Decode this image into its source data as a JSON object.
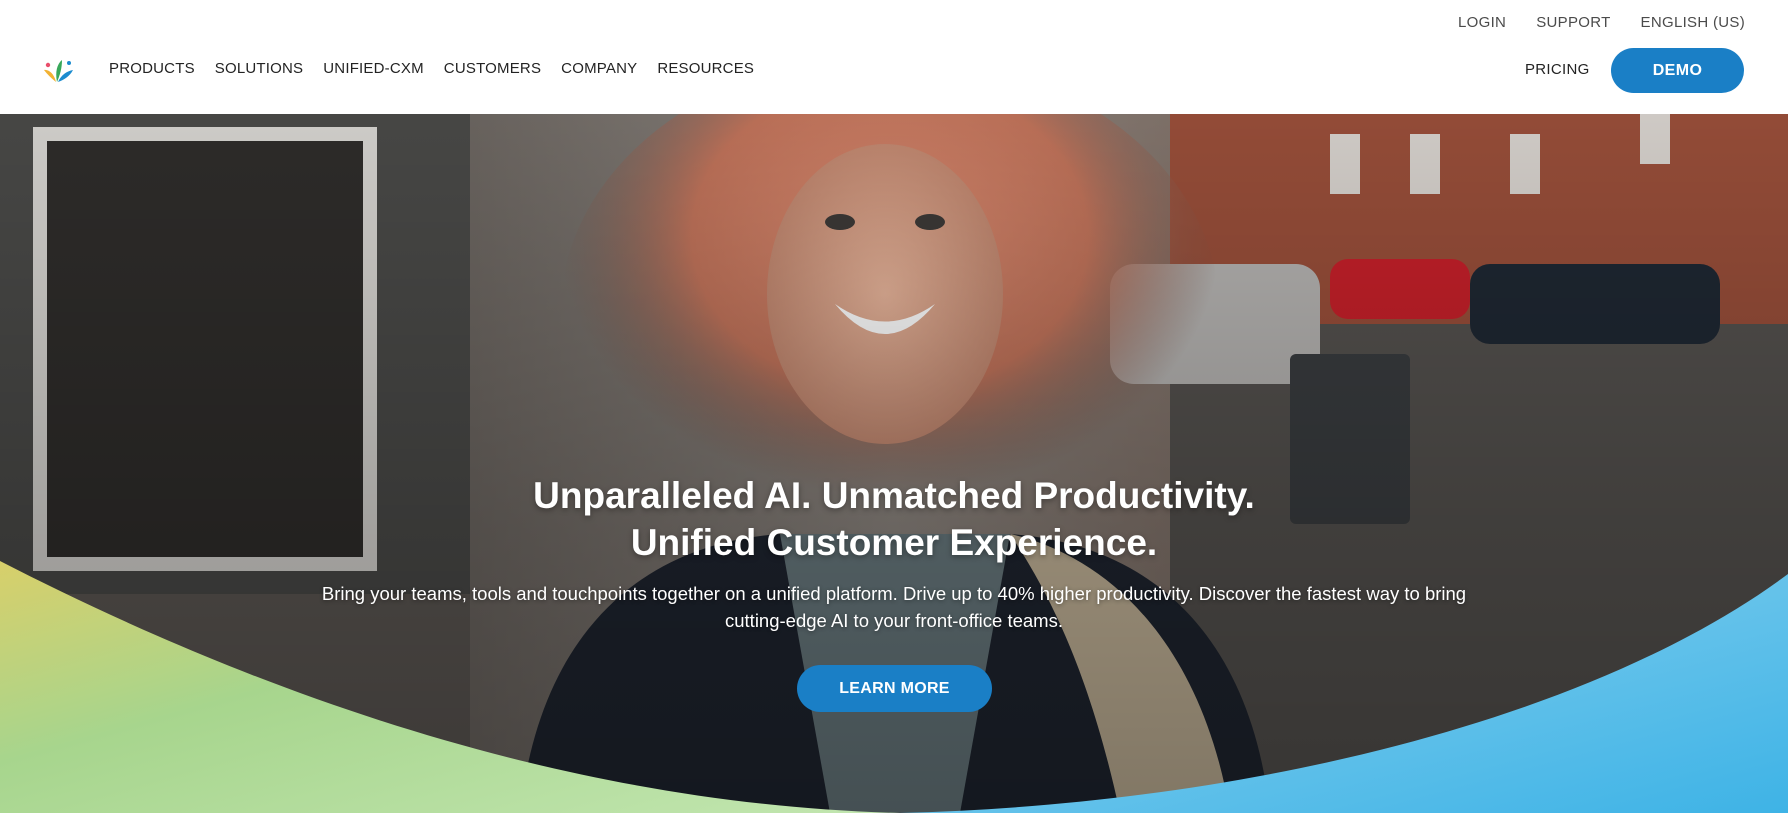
{
  "utility_nav": [
    {
      "label": "LOGIN"
    },
    {
      "label": "SUPPORT"
    },
    {
      "label": "ENGLISH (US)"
    }
  ],
  "main_nav": [
    {
      "label": "PRODUCTS"
    },
    {
      "label": "SOLUTIONS"
    },
    {
      "label": "UNIFIED-CXM"
    },
    {
      "label": "CUSTOMERS"
    },
    {
      "label": "COMPANY"
    },
    {
      "label": "RESOURCES"
    }
  ],
  "header": {
    "logo_icon": "brand-splash-logo",
    "pricing_label": "PRICING",
    "demo_label": "DEMO"
  },
  "hero": {
    "headline_line1": "Unparalleled AI. Unmatched Productivity.",
    "headline_line2": "Unified Customer Experience.",
    "subcopy": "Bring your teams, tools and touchpoints together on a unified platform. Drive up to 40% higher productivity. Discover the fastest way to bring cutting-edge AI to your front-office teams.",
    "cta_label": "LEARN MORE",
    "image_subject": "smiling-woman-with-windblown-hair-photo"
  },
  "colors": {
    "accent": "#1a7fc6",
    "wave_left": "#a9d68a",
    "wave_right": "#5bc4ea"
  }
}
